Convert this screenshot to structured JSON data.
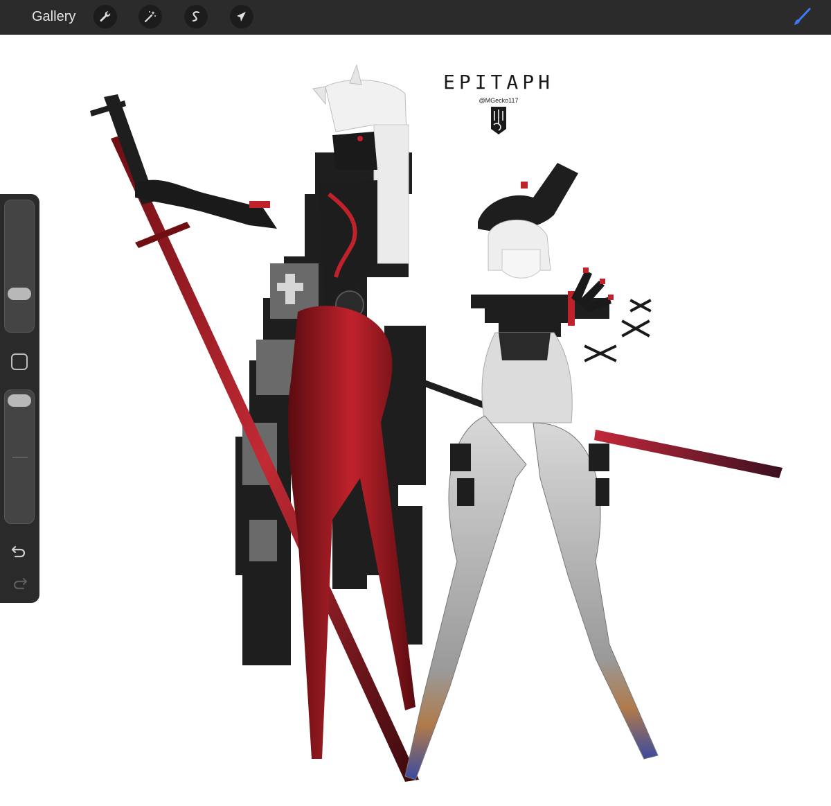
{
  "toolbar": {
    "gallery_label": "Gallery",
    "tools": [
      {
        "name": "actions",
        "icon": "wrench-icon"
      },
      {
        "name": "adjustments",
        "icon": "magic-wand-icon"
      },
      {
        "name": "selection",
        "icon": "selection-s-icon"
      },
      {
        "name": "transform",
        "icon": "arrow-cursor-icon"
      }
    ],
    "active_tool": {
      "name": "brush",
      "icon": "brush-icon",
      "color": "#3d7bf5"
    }
  },
  "sidebar": {
    "brush_size_level": 0.72,
    "opacity_level": 0.94,
    "modify_icon": "square-icon",
    "undo_icon": "undo-icon",
    "redo_icon": "redo-icon"
  },
  "artwork": {
    "title_text": "EPITAPH",
    "handle_text": "@MGecko117",
    "colors": {
      "red": "#b01822",
      "dark_red": "#6e0f14",
      "black": "#1d1d1d",
      "grey": "#8a8a8a",
      "light_grey": "#d8d8d8",
      "white": "#f2f2f2"
    }
  }
}
